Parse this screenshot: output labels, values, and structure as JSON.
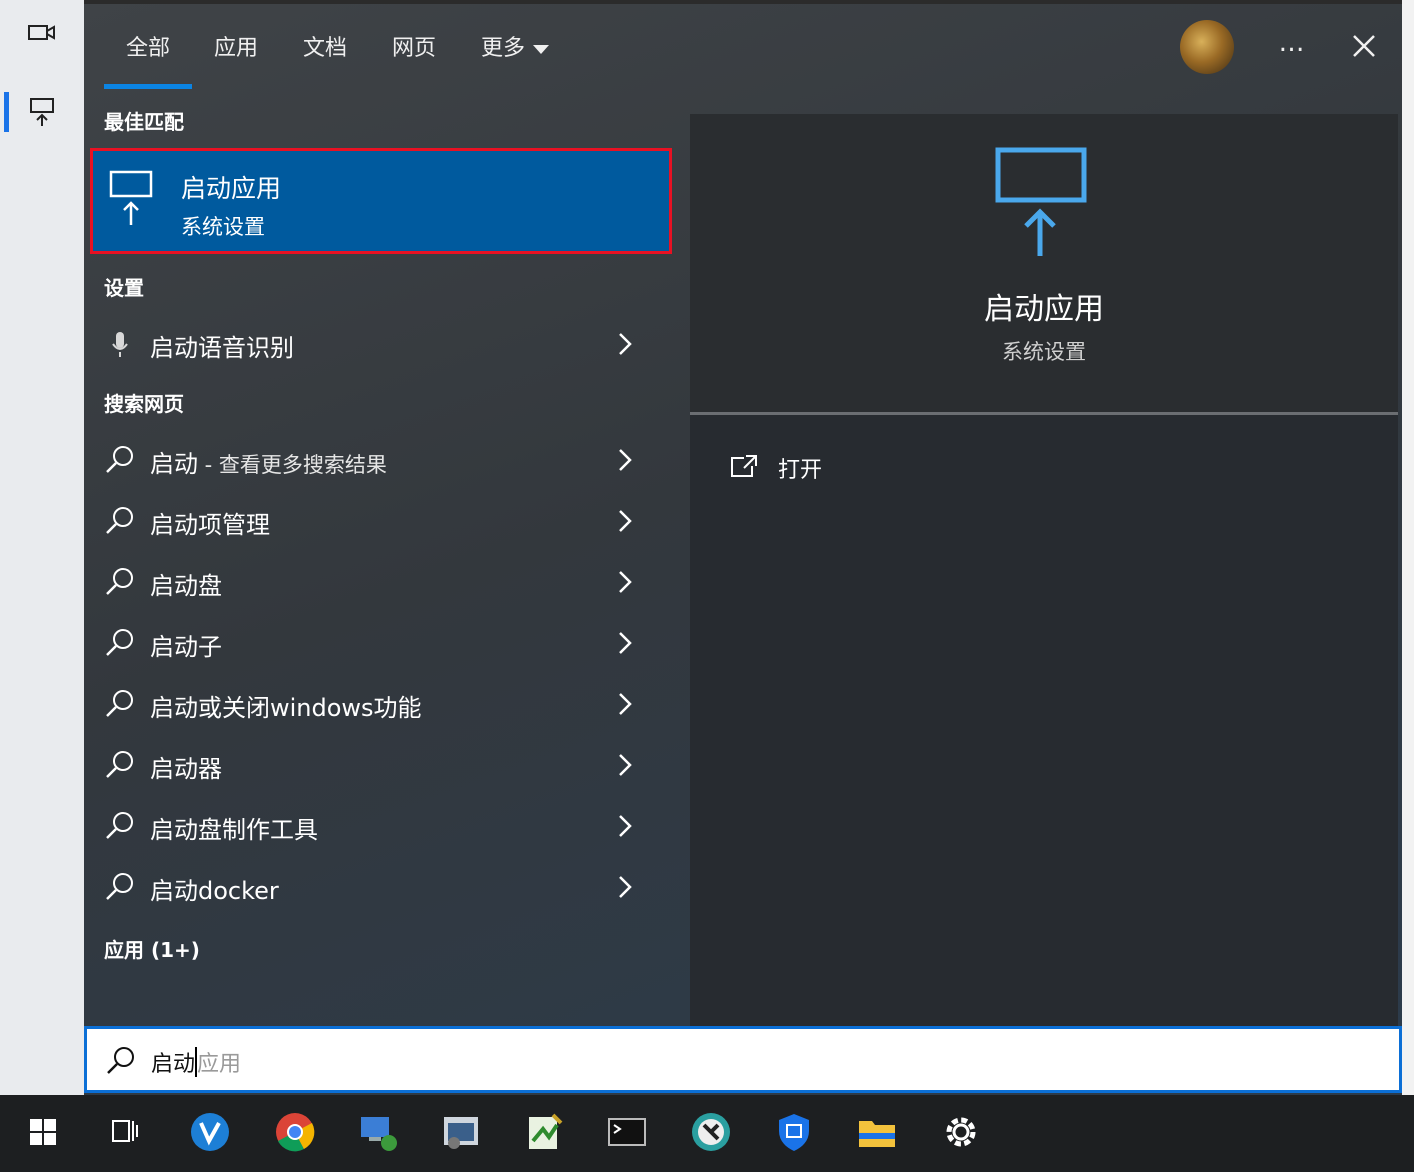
{
  "tabs": [
    {
      "label": "全部",
      "active": true
    },
    {
      "label": "应用"
    },
    {
      "label": "文档"
    },
    {
      "label": "网页"
    },
    {
      "label": "更多"
    }
  ],
  "more_icon": "…",
  "sections": {
    "best_match": "最佳匹配",
    "settings": "设置",
    "web": "搜索网页",
    "apps": "应用 (1+)"
  },
  "best_match": {
    "title": "启动应用",
    "subtitle": "系统设置"
  },
  "settings_items": [
    {
      "label": "启动语音识别",
      "icon": "microphone-icon"
    }
  ],
  "web_items": [
    {
      "label": "启动",
      "suffix": " - 查看更多搜索结果"
    },
    {
      "label": "启动项管理"
    },
    {
      "label": "启动盘"
    },
    {
      "label": "启动子"
    },
    {
      "label": "启动或关闭windows功能"
    },
    {
      "label": "启动器"
    },
    {
      "label": "启动盘制作工具"
    },
    {
      "label": "启动docker"
    }
  ],
  "detail": {
    "title": "启动应用",
    "subtitle": "系统设置",
    "open_label": "打开"
  },
  "search": {
    "typed": "启动",
    "suggestion": "应用"
  },
  "taskbar": [
    "windows-start-icon",
    "task-view-icon",
    "vmware-icon",
    "chrome-icon",
    "network-icon",
    "remote-desktop-icon",
    "notepad-icon",
    "terminal-icon",
    "game-icon",
    "security-shield-icon",
    "file-explorer-icon",
    "settings-gear-icon"
  ],
  "colors": {
    "accent": "#0b84e3",
    "selection": "#005a9e",
    "highlight_border": "#e81123",
    "icon_blue": "#4aa8ec"
  }
}
